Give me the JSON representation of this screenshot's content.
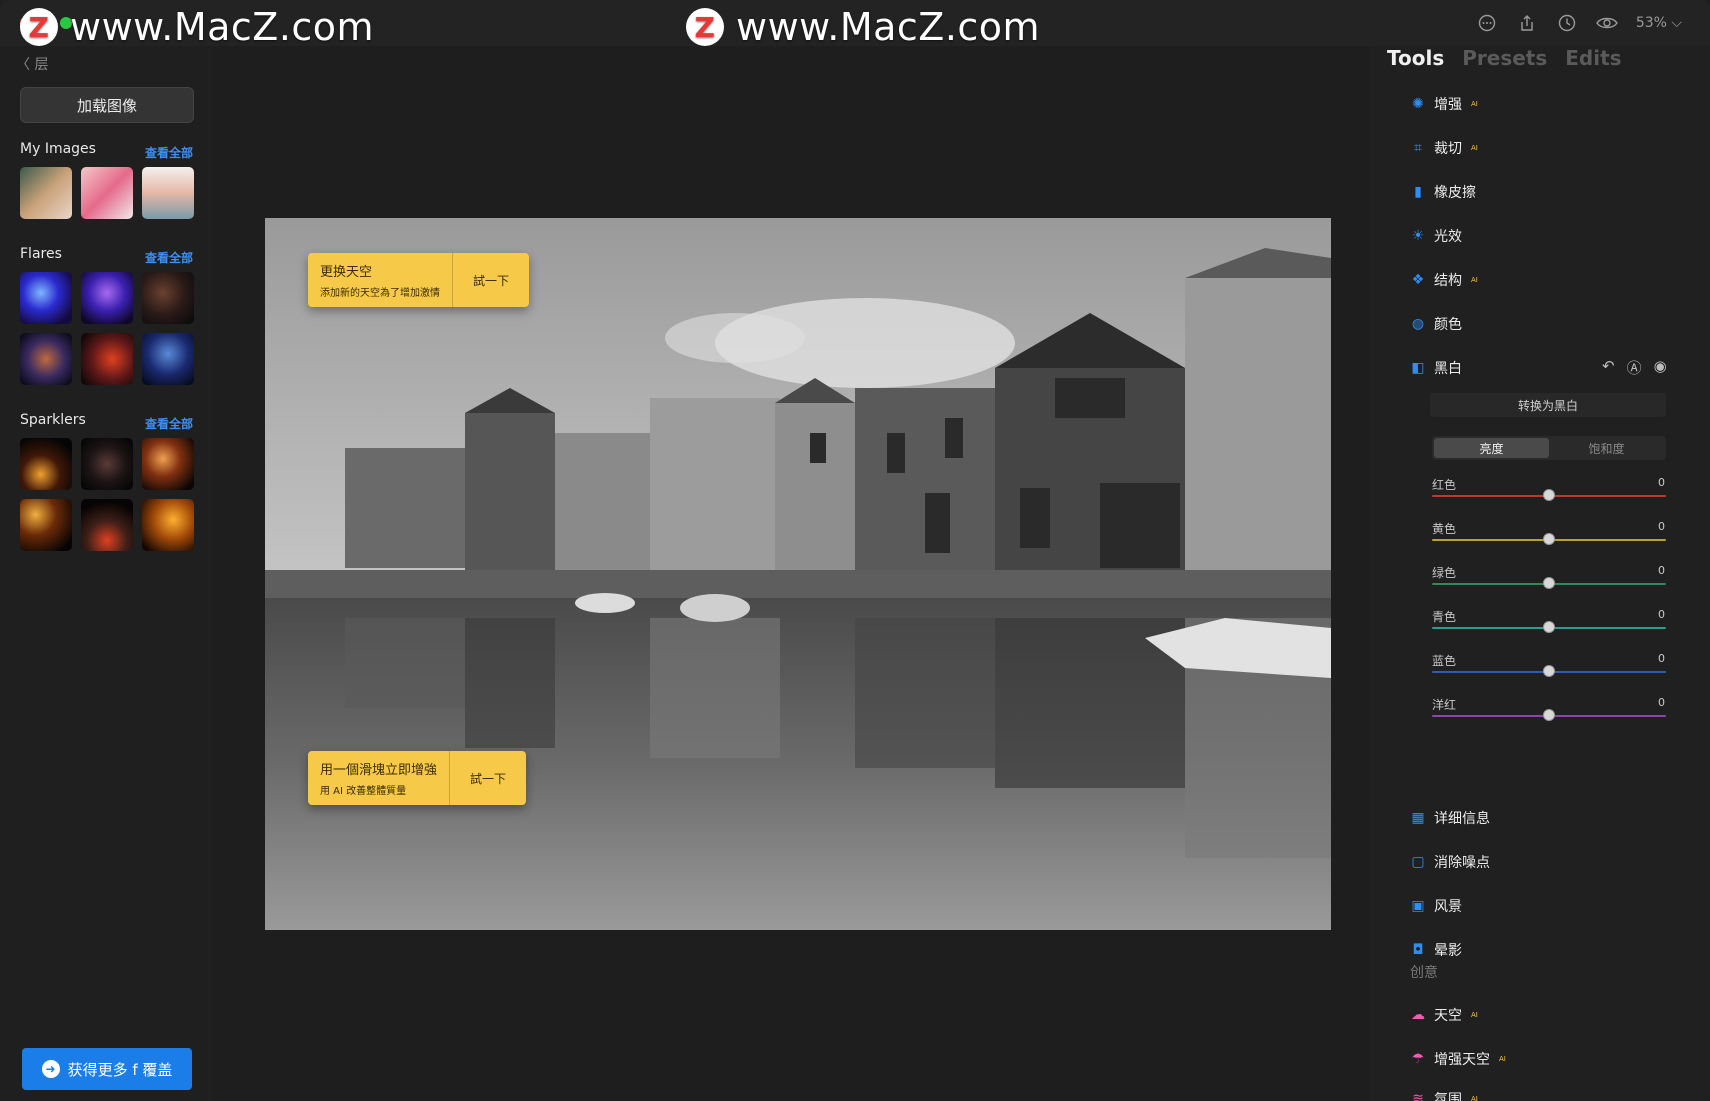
{
  "watermark": {
    "text": "www.MacZ.com",
    "z": "Z"
  },
  "titlebar": {
    "zoom": "53% ⌵"
  },
  "left": {
    "back": "〈 层",
    "load_button": "加载图像",
    "my_images": {
      "title": "My Images",
      "view_all": "查看全部"
    },
    "flares": {
      "title": "Flares",
      "view_all": "查看全部"
    },
    "sparklers": {
      "title": "Sparklers",
      "view_all": "查看全部"
    },
    "cta": "获得更多 f 覆盖"
  },
  "canvas": {
    "pill1": {
      "title": "更换天空",
      "subtitle": "添加新的天空為了增加激情",
      "button": "試一下"
    },
    "pill2": {
      "title": "用一個滑塊立即增強",
      "subtitle": "用 AI 改善整體質量",
      "button": "試一下"
    }
  },
  "right": {
    "tabs": [
      "Tools",
      "Presets",
      "Edits"
    ],
    "tools": [
      {
        "label": "增强",
        "ai": "AI",
        "icon": "enhance-icon"
      },
      {
        "label": "裁切",
        "ai": "AI",
        "icon": "crop-icon"
      },
      {
        "label": "橡皮擦",
        "ai": "",
        "icon": "eraser-icon"
      },
      {
        "label": "光效",
        "ai": "",
        "icon": "light-icon"
      },
      {
        "label": "结构",
        "ai": "AI",
        "icon": "structure-icon"
      },
      {
        "label": "颜色",
        "ai": "",
        "icon": "color-icon"
      },
      {
        "label": "黑白",
        "ai": "",
        "icon": "bw-icon"
      }
    ],
    "bw": {
      "convert": "转换为黑白",
      "segments": [
        "亮度",
        "饱和度"
      ],
      "sliders": [
        {
          "label": "红色",
          "value": "0",
          "color": "#c0392b"
        },
        {
          "label": "黄色",
          "value": "0",
          "color": "#b8a12a"
        },
        {
          "label": "绿色",
          "value": "0",
          "color": "#2e8b57"
        },
        {
          "label": "青色",
          "value": "0",
          "color": "#2a9d8f"
        },
        {
          "label": "蓝色",
          "value": "0",
          "color": "#2f5db5"
        },
        {
          "label": "洋红",
          "value": "0",
          "color": "#8e44ad"
        }
      ]
    },
    "tools2": [
      {
        "label": "详细信息",
        "icon": "details-icon"
      },
      {
        "label": "消除噪点",
        "icon": "denoise-icon"
      },
      {
        "label": "风景",
        "icon": "landscape-icon"
      },
      {
        "label": "晕影",
        "icon": "vignette-icon"
      }
    ],
    "creative_title": "创意",
    "creative_tools": [
      {
        "label": "天空",
        "ai": "AI"
      },
      {
        "label": "增强天空",
        "ai": "AI"
      },
      {
        "label": "氛围",
        "ai": "AI"
      }
    ]
  }
}
